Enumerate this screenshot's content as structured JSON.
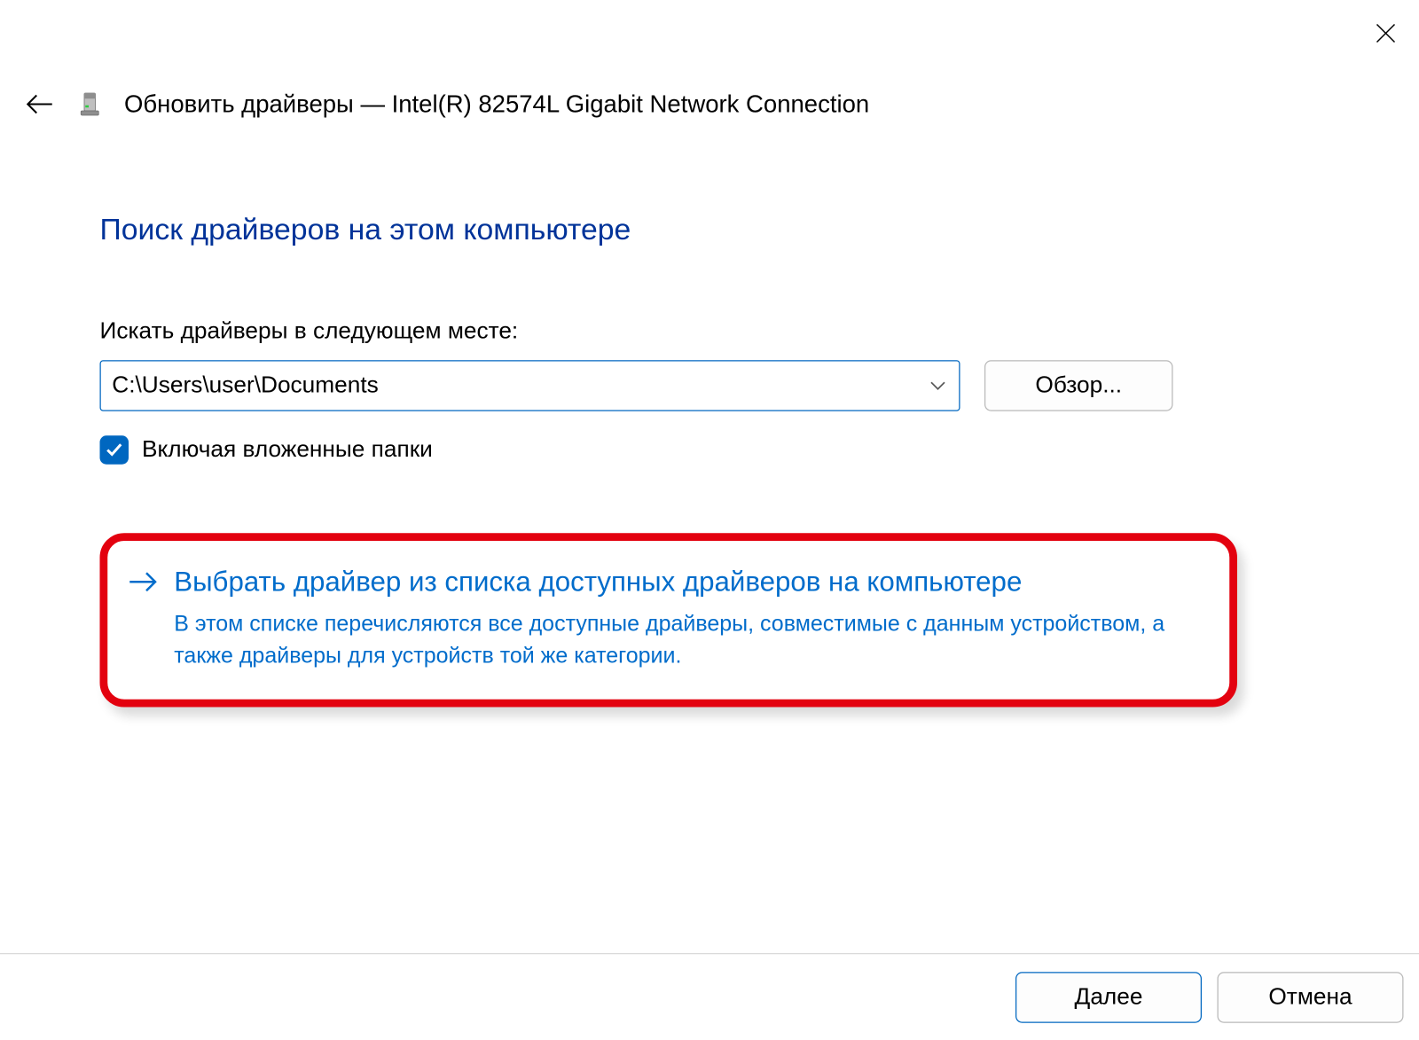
{
  "header": {
    "title": "Обновить драйверы — Intel(R) 82574L Gigabit Network Connection"
  },
  "main": {
    "heading": "Поиск драйверов на этом компьютере",
    "search_location_label": "Искать драйверы в следующем месте:",
    "path_value": "C:\\Users\\user\\Documents",
    "browse_button": "Обзор...",
    "include_subfolders_label": "Включая вложенные папки",
    "include_subfolders_checked": true
  },
  "option": {
    "title": "Выбрать драйвер из списка доступных драйверов на компьютере",
    "description": "В этом списке перечисляются все доступные драйверы, совместимые с данным устройством, а также драйверы для устройств той же категории."
  },
  "footer": {
    "next": "Далее",
    "cancel": "Отмена"
  }
}
